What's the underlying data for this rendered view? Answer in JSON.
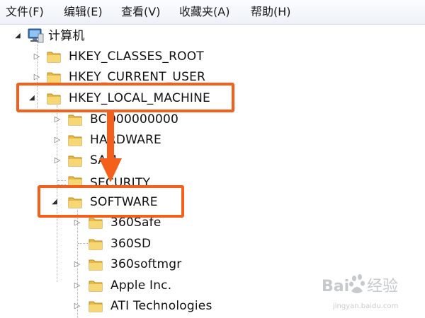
{
  "menu": [
    {
      "label": "文件(F)"
    },
    {
      "label": "编辑(E)"
    },
    {
      "label": "查看(V)"
    },
    {
      "label": "收藏夹(A)"
    },
    {
      "label": "帮助(H)"
    }
  ],
  "tree": {
    "root": "计算机",
    "hives": {
      "classes_root": "HKEY_CLASSES_ROOT",
      "current_user": "HKEY_CURRENT_USER",
      "local_machine": "HKEY_LOCAL_MACHINE"
    },
    "local_machine_children": {
      "bcd": "BCD00000000",
      "hardware": "HARDWARE",
      "sam": "SAM",
      "security": "SECURITY",
      "software": "SOFTWARE"
    },
    "software_children": {
      "safe360": "360Safe",
      "sd360": "360SD",
      "softmgr360": "360softmgr",
      "apple": "Apple Inc.",
      "ati": "ATI Technologies"
    }
  },
  "annotation": {
    "highlight_color": "#f4601b",
    "highlighted": [
      "HKEY_LOCAL_MACHINE",
      "SOFTWARE"
    ]
  },
  "watermark": {
    "brand": "Baidu 经验",
    "url": "jingyan.baidu.com"
  },
  "icons": {
    "computer": "computer-icon",
    "folder": "folder-icon",
    "expand_closed": "triangle-right",
    "expand_open": "triangle-down"
  }
}
